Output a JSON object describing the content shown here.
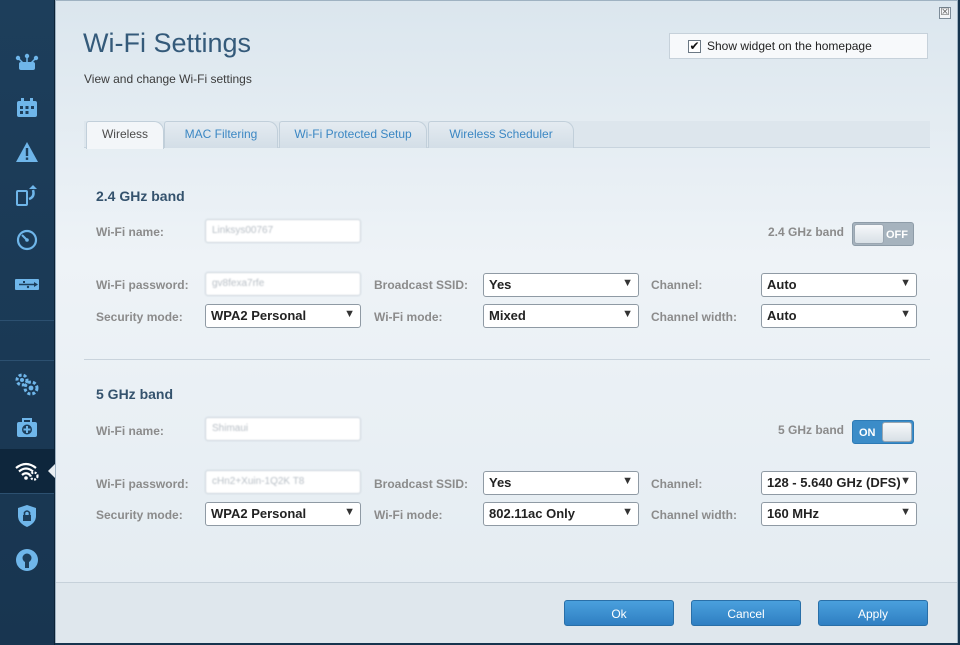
{
  "page": {
    "title": "Wi-Fi Settings",
    "subtitle": "View and change Wi-Fi settings",
    "widget_label": "Show widget on the homepage",
    "widget_checked": true,
    "close_glyph": "☒"
  },
  "sidebar": {
    "items": [
      {
        "name": "rail-item-device-list",
        "icon": "router-network-icon"
      },
      {
        "name": "rail-item-parental",
        "icon": "calendar-grid-icon"
      },
      {
        "name": "rail-item-troubleshoot",
        "icon": "warning-triangle-icon"
      },
      {
        "name": "rail-item-connectivity",
        "icon": "update-arrows-icon"
      },
      {
        "name": "rail-item-speed-test",
        "icon": "speedometer-icon"
      },
      {
        "name": "rail-item-usb-storage",
        "icon": "usb-icon"
      },
      {
        "name": "rail-item-settings",
        "icon": "gears-icon"
      },
      {
        "name": "rail-item-troubleshooting",
        "icon": "first-aid-icon"
      },
      {
        "name": "rail-item-wifi",
        "icon": "wifi-gear-icon",
        "active": true
      },
      {
        "name": "rail-item-security",
        "icon": "lock-shield-icon"
      },
      {
        "name": "rail-item-linksys",
        "icon": "linksys-logo-icon"
      }
    ]
  },
  "tabs": [
    {
      "label": "Wireless",
      "active": true
    },
    {
      "label": "MAC Filtering"
    },
    {
      "label": "Wi-Fi Protected Setup"
    },
    {
      "label": "Wireless Scheduler"
    }
  ],
  "labels": {
    "wifi_name": "Wi-Fi name:",
    "wifi_password": "Wi-Fi password:",
    "security_mode": "Security mode:",
    "broadcast_ssid": "Broadcast SSID:",
    "wifi_mode": "Wi-Fi mode:",
    "channel": "Channel:",
    "channel_width": "Channel width:"
  },
  "band24": {
    "title": "2.4 GHz band",
    "toggle_label": "2.4 GHz band",
    "toggle_state": "OFF",
    "wifi_name": "Linksys00767",
    "wifi_password": "gv8fexa7rfe",
    "security_mode": "WPA2 Personal",
    "broadcast_ssid": "Yes",
    "wifi_mode": "Mixed",
    "channel": "Auto",
    "channel_width": "Auto"
  },
  "band5": {
    "title": "5 GHz band",
    "toggle_label": "5 GHz band",
    "toggle_state": "ON",
    "wifi_name": "Shimaui",
    "wifi_password": "cHn2+Xuin-1Q2K T8",
    "security_mode": "WPA2 Personal",
    "broadcast_ssid": "Yes",
    "wifi_mode": "802.11ac Only",
    "channel": "128 - 5.640 GHz (DFS)",
    "channel_width": "160 MHz"
  },
  "footer": {
    "ok": "Ok",
    "cancel": "Cancel",
    "apply": "Apply"
  },
  "colors": {
    "rail_bg": "#1d3e5b",
    "accent": "#3b8cc8",
    "title": "#345a7a"
  }
}
